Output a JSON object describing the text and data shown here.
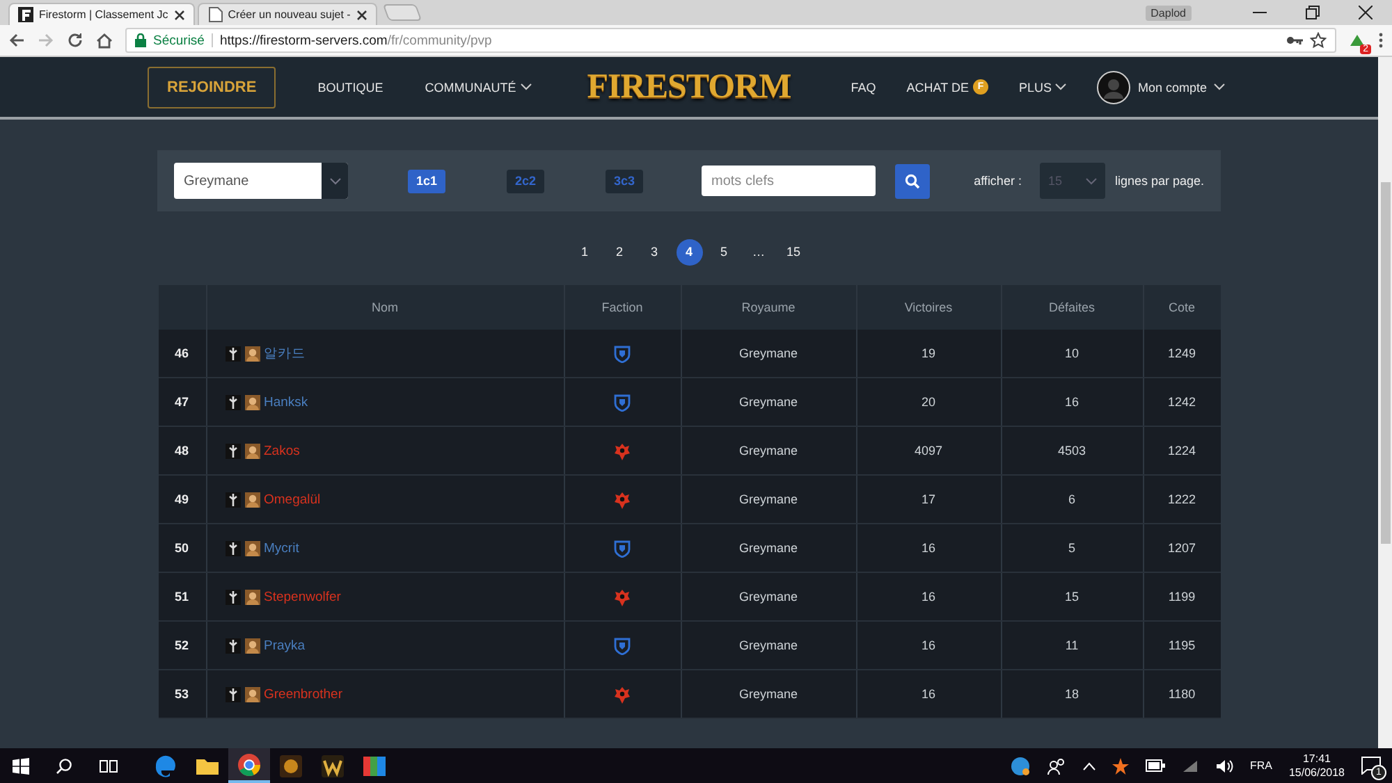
{
  "browser": {
    "tabs": [
      {
        "title": "Firestorm | Classement Jc",
        "selected": true,
        "kind": "site"
      },
      {
        "title": "Créer un nouveau sujet -",
        "selected": false,
        "kind": "page"
      }
    ],
    "user": "Daplod",
    "security": "Sécurisé",
    "url_host": "https://firestorm-servers.com",
    "url_path": "/fr/community/pvp",
    "extension_badge": "2"
  },
  "nav": {
    "join": "REJOINDRE",
    "logo": "FIRESTORM",
    "left": [
      {
        "label": "BOUTIQUE",
        "dropdown": false
      },
      {
        "label": "COMMUNAUTÉ",
        "dropdown": true
      }
    ],
    "right": [
      {
        "label": "FAQ",
        "dropdown": false
      },
      {
        "label": "ACHAT DE",
        "coin": "F",
        "dropdown": false
      },
      {
        "label": "PLUS",
        "dropdown": true
      }
    ],
    "account": "Mon compte"
  },
  "filters": {
    "realm": "Greymane",
    "modes": [
      {
        "label": "1c1",
        "selected": true
      },
      {
        "label": "2c2",
        "selected": false
      },
      {
        "label": "3c3",
        "selected": false
      }
    ],
    "search": {
      "placeholder": "mots clefs"
    },
    "per_page": {
      "label": "afficher :",
      "value": "15",
      "suffix": "lignes par page."
    }
  },
  "pagination": [
    {
      "label": "1",
      "kind": "page",
      "selected": false
    },
    {
      "label": "2",
      "kind": "page",
      "selected": false
    },
    {
      "label": "3",
      "kind": "page",
      "selected": false
    },
    {
      "label": "4",
      "kind": "page",
      "selected": true
    },
    {
      "label": "5",
      "kind": "page",
      "selected": false
    },
    {
      "label": "…",
      "kind": "ellipsis"
    },
    {
      "label": "15",
      "kind": "page",
      "selected": false
    }
  ],
  "table": {
    "columns": [
      "Nom",
      "Faction",
      "Royaume",
      "Victoires",
      "Défaites",
      "Cote"
    ],
    "rows": [
      {
        "rank": "46",
        "name": "알카드",
        "kind": "alliance",
        "realm": "Greymane",
        "wins": "19",
        "losses": "10",
        "rating": "1249"
      },
      {
        "rank": "47",
        "name": "Hanksk",
        "kind": "alliance",
        "realm": "Greymane",
        "wins": "20",
        "losses": "16",
        "rating": "1242"
      },
      {
        "rank": "48",
        "name": "Zakos",
        "kind": "horde",
        "realm": "Greymane",
        "wins": "4097",
        "losses": "4503",
        "rating": "1224"
      },
      {
        "rank": "49",
        "name": "Omegalül",
        "kind": "horde",
        "realm": "Greymane",
        "wins": "17",
        "losses": "6",
        "rating": "1222"
      },
      {
        "rank": "50",
        "name": "Mycrit",
        "kind": "alliance",
        "realm": "Greymane",
        "wins": "16",
        "losses": "5",
        "rating": "1207"
      },
      {
        "rank": "51",
        "name": "Stepenwolfer",
        "kind": "horde",
        "realm": "Greymane",
        "wins": "16",
        "losses": "15",
        "rating": "1199"
      },
      {
        "rank": "52",
        "name": "Prayka",
        "kind": "alliance",
        "realm": "Greymane",
        "wins": "16",
        "losses": "11",
        "rating": "1195"
      },
      {
        "rank": "53",
        "name": "Greenbrother",
        "kind": "horde",
        "realm": "Greymane",
        "wins": "16",
        "losses": "18",
        "rating": "1180"
      }
    ]
  },
  "taskbar": {
    "apps": [
      {
        "kind": "edge",
        "active": false
      },
      {
        "kind": "folder",
        "active": false
      },
      {
        "kind": "chrome",
        "active": true
      },
      {
        "kind": "game",
        "active": false
      },
      {
        "kind": "wow",
        "active": false
      },
      {
        "kind": "palette",
        "active": false
      }
    ],
    "language": "FRA",
    "time": "17:41",
    "date": "15/06/2018",
    "notifications": "1"
  }
}
